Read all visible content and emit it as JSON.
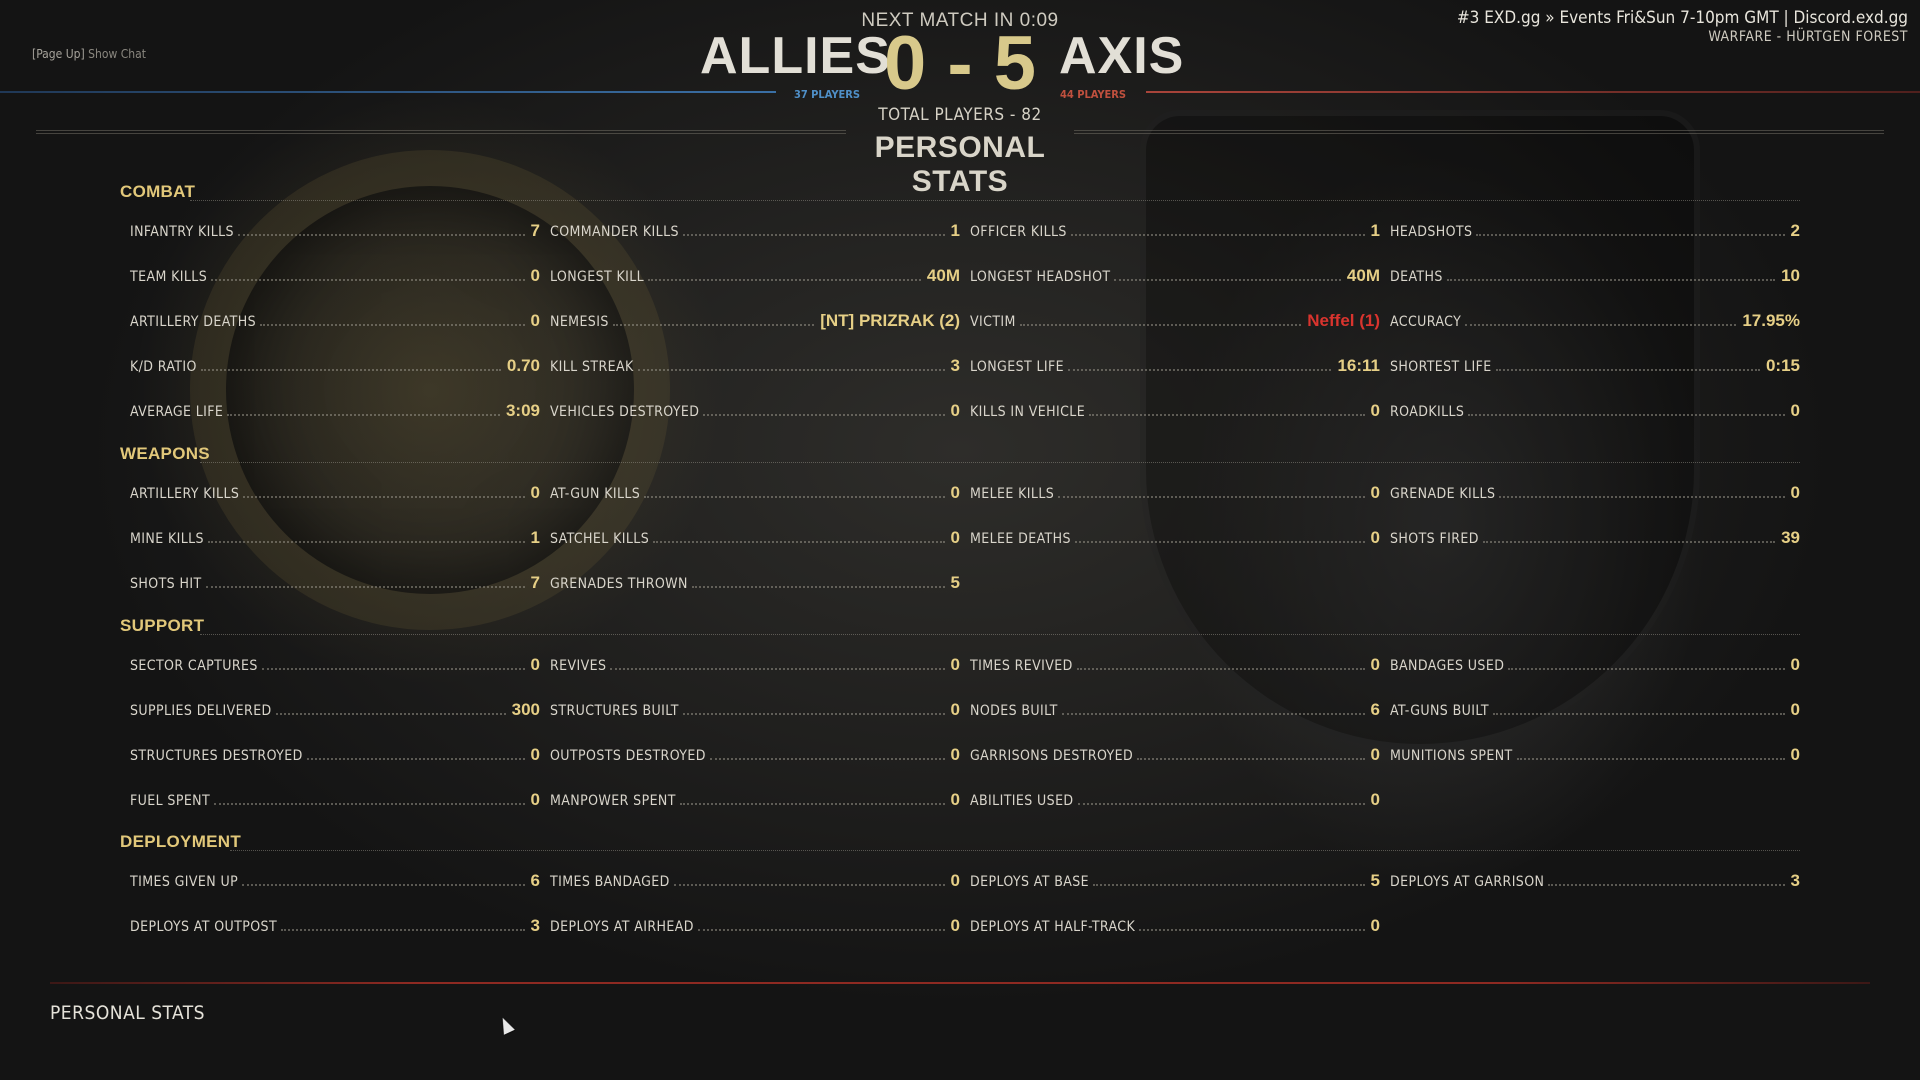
{
  "header": {
    "chat_key": "[Page Up]",
    "chat_label": "Show Chat",
    "next_match": "NEXT MATCH IN 0:09",
    "allies_name": "ALLIES",
    "axis_name": "AXIS",
    "score": "0 - 5",
    "allies_players": "37 PLAYERS",
    "axis_players": "44 PLAYERS",
    "total_players": "TOTAL PLAYERS - 82",
    "server_name": "#3 EXD.gg » Events Fri&Sun 7-10pm GMT | Discord.exd.gg",
    "map_name": "WARFARE - HÜRTGEN FOREST",
    "page_title": "PERSONAL STATS"
  },
  "sections": [
    {
      "name": "COMBAT",
      "stats": [
        {
          "label": "INFANTRY KILLS",
          "value": "7"
        },
        {
          "label": "COMMANDER KILLS",
          "value": "1"
        },
        {
          "label": "OFFICER KILLS",
          "value": "1"
        },
        {
          "label": "HEADSHOTS",
          "value": "2"
        },
        {
          "label": "TEAM KILLS",
          "value": "0"
        },
        {
          "label": "LONGEST KILL",
          "value": "40M"
        },
        {
          "label": "LONGEST HEADSHOT",
          "value": "40M"
        },
        {
          "label": "DEATHS",
          "value": "10"
        },
        {
          "label": "ARTILLERY DEATHS",
          "value": "0"
        },
        {
          "label": "NEMESIS",
          "value": "[NT] PRIZRAK (2)"
        },
        {
          "label": "VICTIM",
          "value": "Neffel (1)",
          "highlight": "red"
        },
        {
          "label": "ACCURACY",
          "value": "17.95%"
        },
        {
          "label": "K/D RATIO",
          "value": "0.70"
        },
        {
          "label": "KILL STREAK",
          "value": "3"
        },
        {
          "label": "LONGEST LIFE",
          "value": "16:11"
        },
        {
          "label": "SHORTEST LIFE",
          "value": "0:15"
        },
        {
          "label": "AVERAGE LIFE",
          "value": "3:09"
        },
        {
          "label": "VEHICLES DESTROYED",
          "value": "0"
        },
        {
          "label": "KILLS IN VEHICLE",
          "value": "0"
        },
        {
          "label": "ROADKILLS",
          "value": "0"
        }
      ]
    },
    {
      "name": "WEAPONS",
      "stats": [
        {
          "label": "ARTILLERY KILLS",
          "value": "0"
        },
        {
          "label": "AT-GUN KILLS",
          "value": "0"
        },
        {
          "label": "MELEE KILLS",
          "value": "0"
        },
        {
          "label": "GRENADE KILLS",
          "value": "0"
        },
        {
          "label": "MINE KILLS",
          "value": "1"
        },
        {
          "label": "SATCHEL KILLS",
          "value": "0"
        },
        {
          "label": "MELEE DEATHS",
          "value": "0"
        },
        {
          "label": "SHOTS FIRED",
          "value": "39"
        },
        {
          "label": "SHOTS HIT",
          "value": "7"
        },
        {
          "label": "GRENADES THROWN",
          "value": "5"
        }
      ]
    },
    {
      "name": "SUPPORT",
      "stats": [
        {
          "label": "SECTOR CAPTURES",
          "value": "0"
        },
        {
          "label": "REVIVES",
          "value": "0"
        },
        {
          "label": "TIMES REVIVED",
          "value": "0"
        },
        {
          "label": "BANDAGES USED",
          "value": "0"
        },
        {
          "label": "SUPPLIES DELIVERED",
          "value": "300"
        },
        {
          "label": "STRUCTURES BUILT",
          "value": "0"
        },
        {
          "label": "NODES BUILT",
          "value": "6"
        },
        {
          "label": "AT-GUNS BUILT",
          "value": "0"
        },
        {
          "label": "STRUCTURES DESTROYED",
          "value": "0"
        },
        {
          "label": "OUTPOSTS DESTROYED",
          "value": "0"
        },
        {
          "label": "GARRISONS DESTROYED",
          "value": "0"
        },
        {
          "label": "MUNITIONS SPENT",
          "value": "0"
        },
        {
          "label": "FUEL SPENT",
          "value": "0"
        },
        {
          "label": "MANPOWER SPENT",
          "value": "0"
        },
        {
          "label": "ABILITIES USED",
          "value": "0"
        }
      ]
    },
    {
      "name": "DEPLOYMENT",
      "stats": [
        {
          "label": "TIMES GIVEN UP",
          "value": "6"
        },
        {
          "label": "TIMES BANDAGED",
          "value": "0"
        },
        {
          "label": "DEPLOYS AT BASE",
          "value": "5"
        },
        {
          "label": "DEPLOYS AT GARRISON",
          "value": "3"
        },
        {
          "label": "DEPLOYS AT OUTPOST",
          "value": "3"
        },
        {
          "label": "DEPLOYS AT AIRHEAD",
          "value": "0"
        },
        {
          "label": "DEPLOYS AT HALF-TRACK",
          "value": "0"
        }
      ]
    }
  ],
  "footer": {
    "title": "PERSONAL STATS"
  }
}
